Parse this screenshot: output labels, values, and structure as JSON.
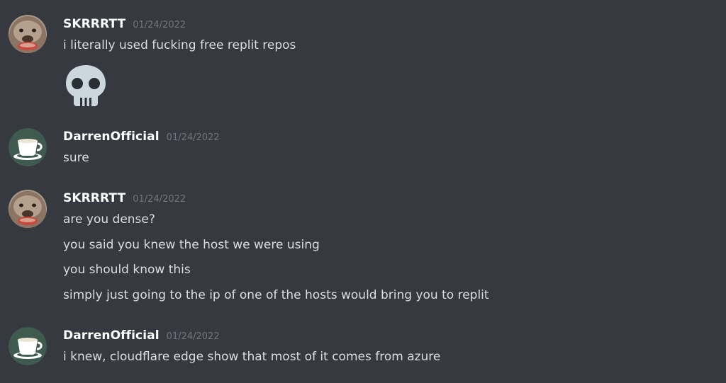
{
  "messages": [
    {
      "author": "SKRRRTT",
      "timestamp": "01/24/2022",
      "avatar_icon": "dog-face-avatar",
      "lines": [
        "i literally used fucking free replit repos"
      ],
      "emoji": "skull-icon"
    },
    {
      "author": "DarrenOfficial",
      "timestamp": "01/24/2022",
      "avatar_icon": "coffee-cup-avatar",
      "lines": [
        "sure"
      ]
    },
    {
      "author": "SKRRRTT",
      "timestamp": "01/24/2022",
      "avatar_icon": "dog-face-avatar",
      "lines": [
        "are you dense?",
        "you said you knew the host we were using",
        "you should know this",
        "simply just going to the ip of one of the hosts would bring you to replit"
      ]
    },
    {
      "author": "DarrenOfficial",
      "timestamp": "01/24/2022",
      "avatar_icon": "coffee-cup-avatar",
      "lines": [
        "i knew, cloudflare edge show that most of it comes from azure"
      ]
    }
  ],
  "colors": {
    "background": "#36393f",
    "username": "#ffffff",
    "timestamp": "#72767d",
    "message_text": "#dcddde",
    "coffee_avatar_bg": "#3f5a4e"
  }
}
